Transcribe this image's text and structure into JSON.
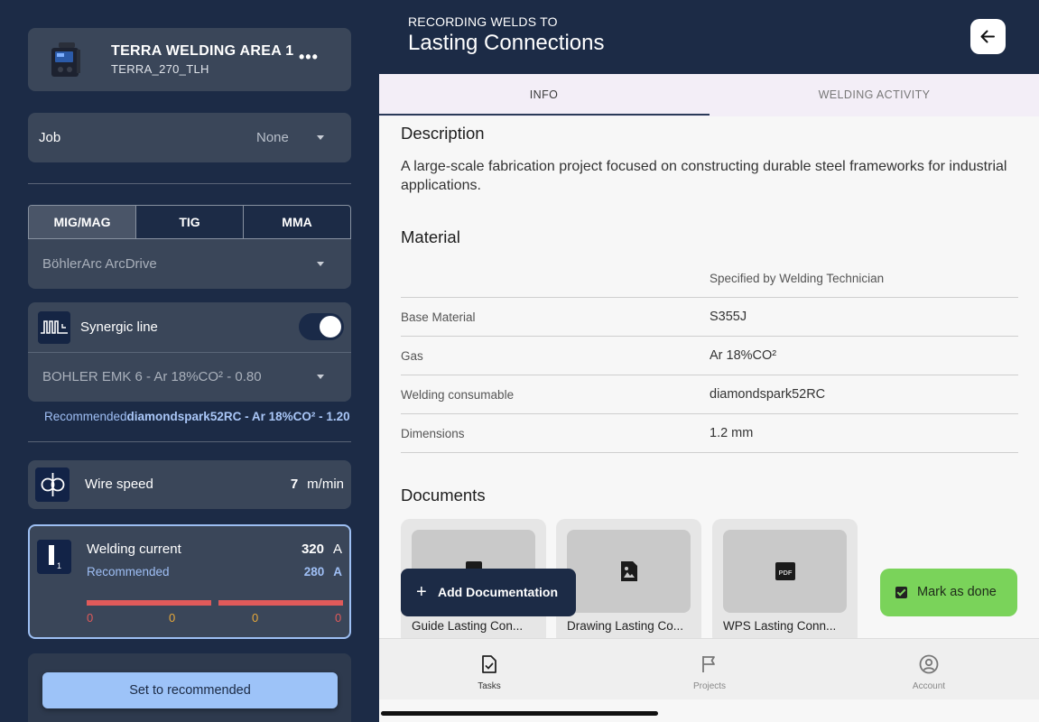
{
  "machine": {
    "name": "TERRA WELDING AREA 1",
    "id": "TERRA_270_TLH",
    "more_icon": "ellipsis-icon"
  },
  "job": {
    "label": "Job",
    "value": "None"
  },
  "process_tabs": [
    {
      "label": "MIG/MAG",
      "active": true
    },
    {
      "label": "TIG",
      "active": false
    },
    {
      "label": "MMA",
      "active": false
    }
  ],
  "process_select": {
    "value": "BöhlerArc ArcDrive"
  },
  "synergic": {
    "label": "Synergic line",
    "enabled": true,
    "line_value": "BOHLER EMK 6 - Ar 18%CO² - 0.80"
  },
  "recommended_line": {
    "prefix": "Recommended",
    "value": "diamondspark52RC - Ar 18%CO² - 1.20"
  },
  "wire_speed": {
    "label": "Wire speed",
    "value": "7",
    "unit": "m/min"
  },
  "welding_current": {
    "label": "Welding current",
    "value": "320",
    "unit": "A",
    "recommended_label": "Recommended",
    "recommended_value": "280",
    "recommended_unit": "A",
    "ticks": [
      "0",
      "0",
      "0",
      "0"
    ]
  },
  "set_recommended": {
    "label": "Set to recommended"
  },
  "header": {
    "subtitle": "RECORDING WELDS TO",
    "title": "Lasting Connections",
    "back_icon": "arrow-left-icon"
  },
  "tabs": [
    {
      "label": "INFO",
      "active": true
    },
    {
      "label": "WELDING ACTIVITY",
      "active": false
    }
  ],
  "description": {
    "title": "Description",
    "text": "A large-scale fabrication project focused on constructing durable steel frameworks for industrial applications."
  },
  "material": {
    "title": "Material",
    "header": "Specified by Welding Technician",
    "rows": [
      {
        "key": "Base Material",
        "value": "S355J"
      },
      {
        "key": "Gas",
        "value": "Ar 18%CO²"
      },
      {
        "key": "Welding consumable",
        "value": "diamondspark52RC"
      },
      {
        "key": "Dimensions",
        "value": "1.2 mm"
      }
    ]
  },
  "documents": {
    "title": "Documents",
    "items": [
      {
        "name": "Guide Lasting Con...",
        "icon": "document-icon"
      },
      {
        "name": "Drawing Lasting Co...",
        "icon": "image-file-icon"
      },
      {
        "name": "WPS Lasting Conn...",
        "icon": "pdf-icon"
      }
    ]
  },
  "add_documentation": {
    "label": "Add Documentation"
  },
  "mark_done": {
    "label": "Mark as done"
  },
  "bottom_nav": [
    {
      "label": "Tasks",
      "icon": "task-icon",
      "active": true
    },
    {
      "label": "Projects",
      "icon": "flag-icon",
      "active": false
    },
    {
      "label": "Account",
      "icon": "account-icon",
      "active": false
    }
  ],
  "colors": {
    "navy": "#1c2b46",
    "card": "#3a4659",
    "accent_blue": "#9dc3f8",
    "danger": "#e05a5a",
    "warning": "#e8a93a",
    "success": "#7ad35a"
  }
}
